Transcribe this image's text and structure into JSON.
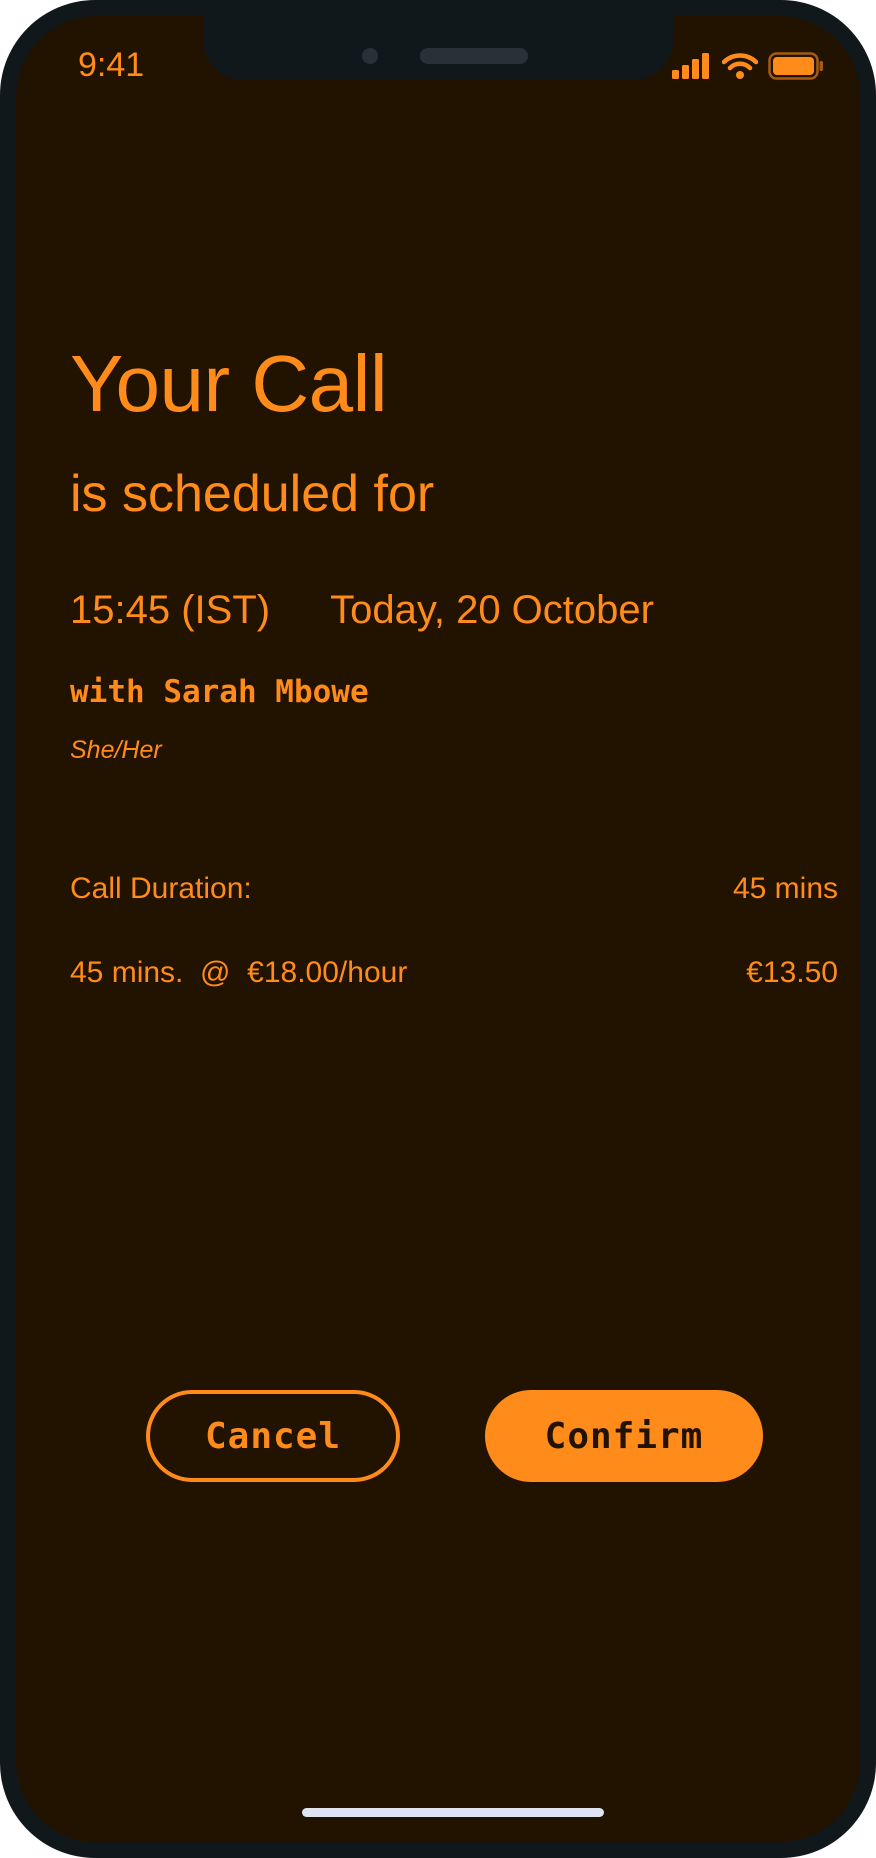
{
  "status_bar": {
    "time": "9:41"
  },
  "booking": {
    "title": "Your Call",
    "subtitle": "is scheduled for",
    "time": "15:45 (IST)",
    "date": "Today, 20 October",
    "with": "with Sarah Mbowe",
    "pronouns": "She/Her"
  },
  "details": {
    "duration_label": "Call Duration:",
    "duration_value": "45 mins",
    "rate_label": "45 mins.  @  €18.00/hour",
    "rate_value": "€13.50"
  },
  "actions": {
    "cancel_label": "Cancel",
    "confirm_label": "Confirm"
  },
  "colors": {
    "background": "#221200",
    "accent": "#ff8c1a",
    "frame": "#11181c"
  },
  "icons": [
    "cellular-signal-icon",
    "wifi-icon",
    "battery-icon"
  ]
}
